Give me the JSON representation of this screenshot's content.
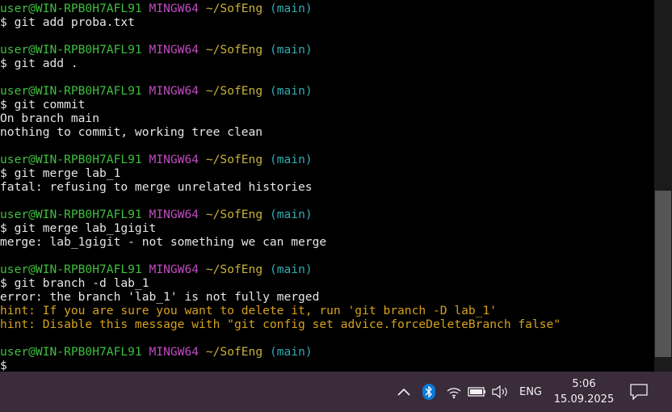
{
  "terminal": {
    "blocks": [
      {
        "user": "user@WIN-RPB0H7AFL91",
        "shell": "MINGW64",
        "path": "~/SofEng",
        "branch": "(main)",
        "command": "$ git add proba.txt",
        "output": []
      },
      {
        "user": "user@WIN-RPB0H7AFL91",
        "shell": "MINGW64",
        "path": "~/SofEng",
        "branch": "(main)",
        "command": "$ git add .",
        "output": []
      },
      {
        "user": "user@WIN-RPB0H7AFL91",
        "shell": "MINGW64",
        "path": "~/SofEng",
        "branch": "(main)",
        "command": "$ git commit",
        "output": [
          "On branch main",
          "nothing to commit, working tree clean"
        ]
      },
      {
        "user": "user@WIN-RPB0H7AFL91",
        "shell": "MINGW64",
        "path": "~/SofEng",
        "branch": "(main)",
        "command": "$ git merge lab_1",
        "output": [
          "fatal: refusing to merge unrelated histories"
        ]
      },
      {
        "user": "user@WIN-RPB0H7AFL91",
        "shell": "MINGW64",
        "path": "~/SofEng",
        "branch": "(main)",
        "command": "$ git merge lab_1gigit",
        "output": [
          "merge: lab_1gigit - not something we can merge"
        ]
      },
      {
        "user": "user@WIN-RPB0H7AFL91",
        "shell": "MINGW64",
        "path": "~/SofEng",
        "branch": "(main)",
        "command": "$ git branch -d lab_1",
        "output": [
          "error: the branch 'lab_1' is not fully merged"
        ],
        "hints": [
          "hint: If you are sure you want to delete it, run 'git branch -D lab_1'",
          "hint: Disable this message with \"git config set advice.forceDeleteBranch false\""
        ]
      },
      {
        "user": "user@WIN-RPB0H7AFL91",
        "shell": "MINGW64",
        "path": "~/SofEng",
        "branch": "(main)",
        "command": "$",
        "output": []
      }
    ]
  },
  "taskbar": {
    "language": "ENG",
    "time": "5:06",
    "date": "15.09.2025",
    "icons": [
      "chevron-up-icon",
      "bluetooth-icon",
      "wifi-icon",
      "battery-icon",
      "volume-icon",
      "notification-icon"
    ]
  },
  "colors": {
    "user": "#3fbf3f",
    "shell": "#c04bc0",
    "path": "#c8b23a",
    "branch": "#33aab3",
    "hint": "#d6a21c",
    "taskbar": "#3a2c3a"
  }
}
